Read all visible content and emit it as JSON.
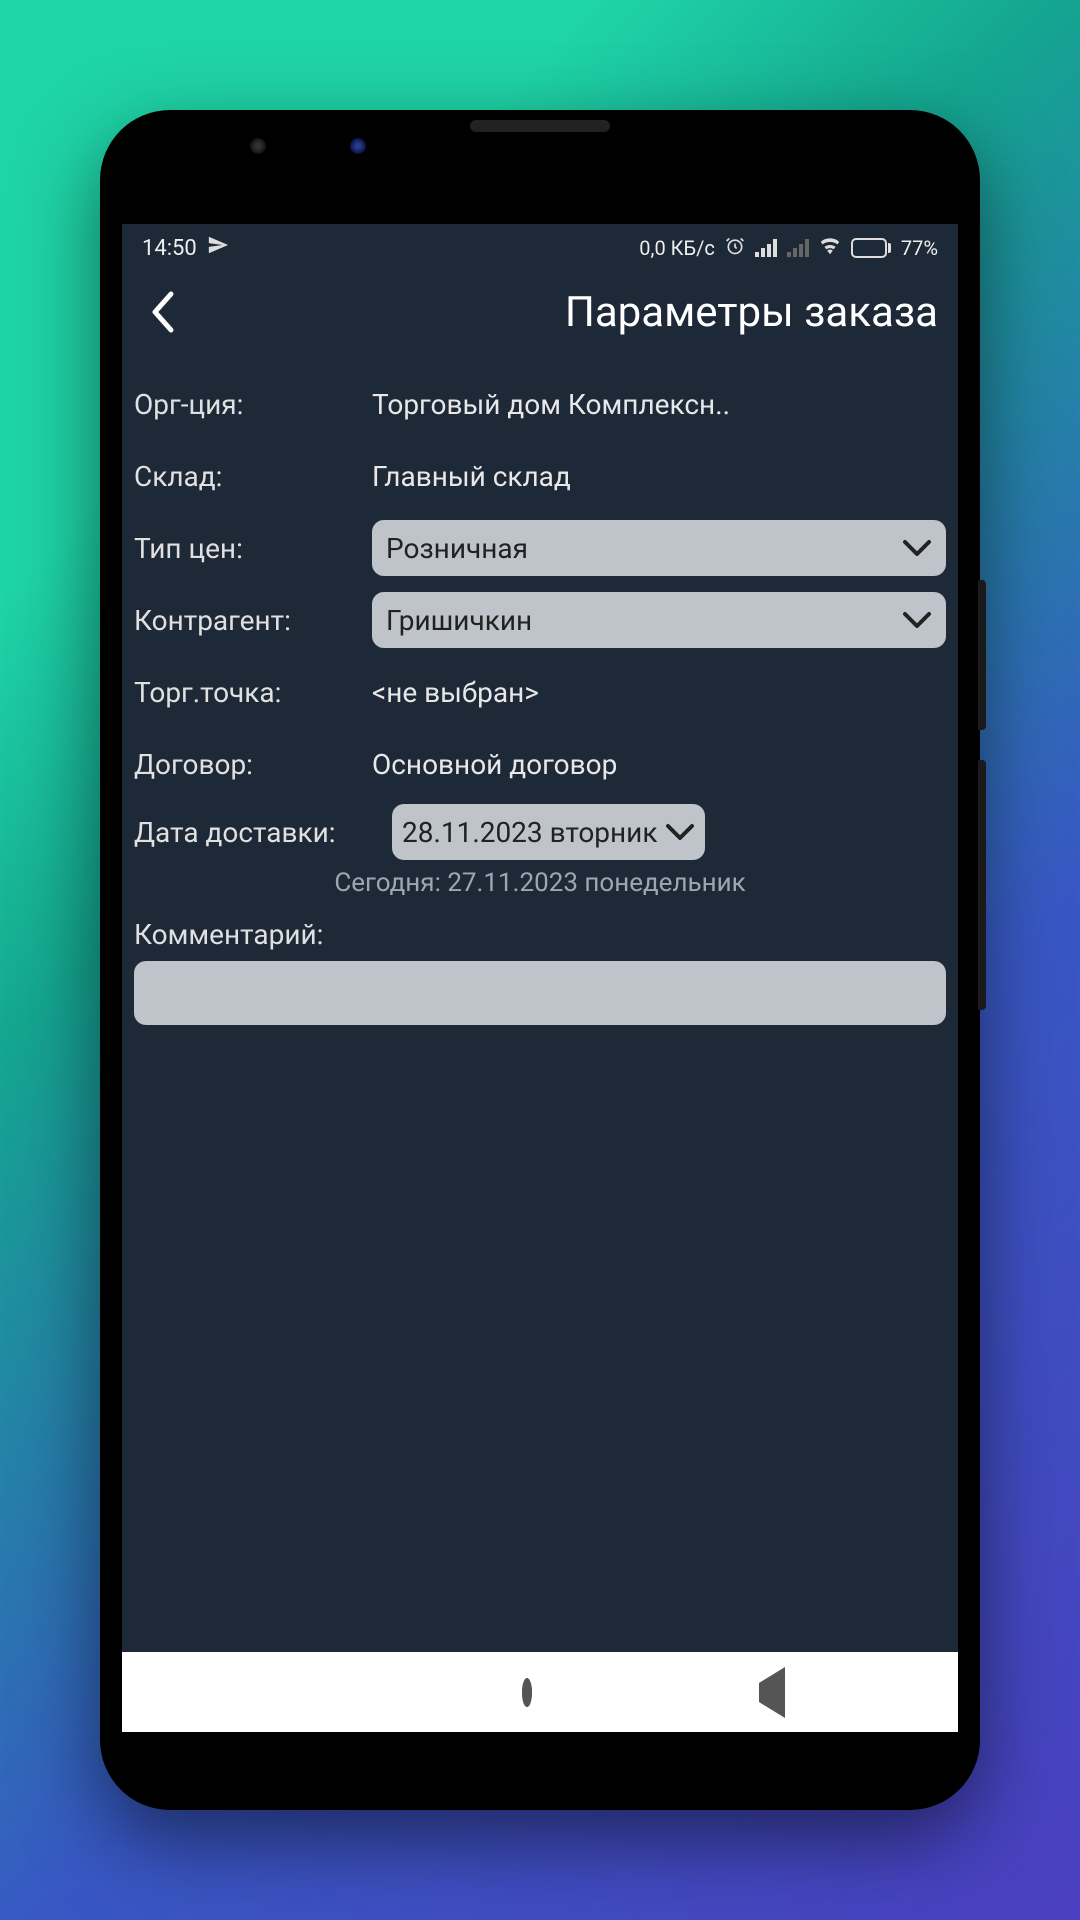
{
  "status": {
    "time": "14:50",
    "speed": "0,0 КБ/с",
    "battery_pct": "77%"
  },
  "header": {
    "title": "Параметры заказа"
  },
  "fields": {
    "org_label": "Орг-ция:",
    "org_value": "Торговый дом Комплексн..",
    "warehouse_label": "Склад:",
    "warehouse_value": "Главный склад",
    "pricetype_label": "Тип цен:",
    "pricetype_value": "Розничная",
    "counterparty_label": "Контрагент:",
    "counterparty_value": "Гришичкин",
    "tradepoint_label": "Торг.точка:",
    "tradepoint_value": "<не выбран>",
    "contract_label": "Договор:",
    "contract_value": "Основной договор",
    "delivery_label": "Дата доставки:",
    "delivery_value": "28.11.2023 вторник",
    "today_line": "Сегодня: 27.11.2023 понедельник",
    "comment_label": "Комментарий:",
    "comment_value": ""
  }
}
